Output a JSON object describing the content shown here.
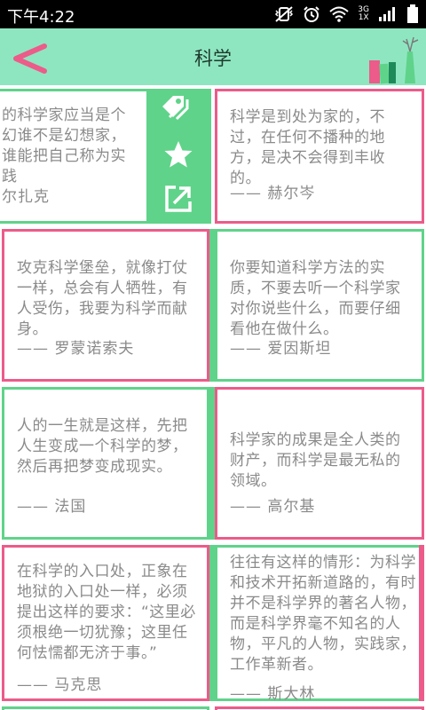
{
  "status_bar": {
    "time": "下午4:22",
    "network_top": "3G",
    "network_bottom": "1X"
  },
  "header": {
    "title": "科学",
    "accent_color": "#8ee6c1"
  },
  "colors": {
    "green": "#5fd38a",
    "pink": "#ec5b8a",
    "text": "#8a8a8a"
  },
  "quotes": [
    {
      "text": "的科学家应当是个幻谁不是幻想家，谁能把自己称为实践",
      "author": "尔扎克"
    },
    {
      "text": "科学是到处为家的，不过，在任何不播种的地方，是决不会得到丰收的。",
      "author": "—— 赫尔岑"
    },
    {
      "text": "攻克科学堡垒，就像打仗一样，总会有人牺牲，有人受伤，我要为科学而献身。",
      "author": "—— 罗蒙诺索夫"
    },
    {
      "text": "你要知道科学方法的实质，不要去听一个科学家对你说些什么，而要仔细看他在做什么。",
      "author": "—— 爱因斯坦"
    },
    {
      "text": "人的一生就是这样，先把人生变成一个科学的梦，然后再把梦变成现实。",
      "author": "—— 法国"
    },
    {
      "text": "科学家的成果是全人类的财产，而科学是最无私的领域。",
      "author": "—— 高尔基"
    },
    {
      "text": "在科学的入口处，正象在地狱的入口处一样，必须提出这样的要求：“这里必须根绝一切犹豫；这里任何怯懦都无济于事。”",
      "author": "—— 马克思"
    },
    {
      "text": "往往有这样的情形：为科学和技术开拓新道路的，有时并不是科学界的著名人物，而是科学界毫不知名的人物，平凡的人物，实践家，工作革新者。",
      "author": "—— 斯大林"
    }
  ],
  "actions": {
    "tag": "tag-icon",
    "favorite": "star-icon",
    "share": "share-icon"
  }
}
